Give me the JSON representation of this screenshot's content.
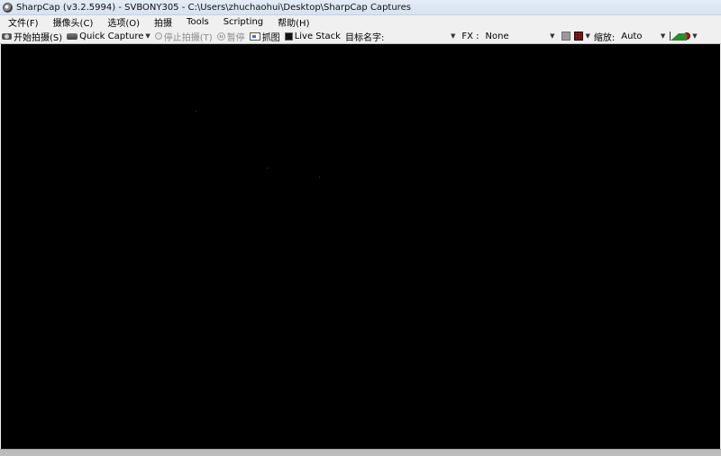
{
  "window": {
    "title": "SharpCap (v3.2.5994) - SVBONY305 - C:\\Users\\zhuchaohui\\Desktop\\SharpCap Captures"
  },
  "menu": {
    "items": [
      "文件(F)",
      "摄像头(C)",
      "选项(O)",
      "拍摄",
      "Tools",
      "Scripting",
      "帮助(H)"
    ]
  },
  "toolbar": {
    "start_capture": "开始拍摄(S)",
    "quick_capture": "Quick Capture",
    "stop_capture": "停止拍摄(T)",
    "pause": "暂停",
    "snapshot": "抓图",
    "live_stack": "Live Stack",
    "target_label": "目标名字:",
    "target_value": "",
    "fx_label": "FX :",
    "fx_value": "None",
    "zoom_label": "缩放:",
    "zoom_value": "Auto"
  },
  "icons": {
    "start_capture": "camera-icon",
    "quick_capture": "quick-capture-icon",
    "stop_capture": "stop-icon",
    "pause": "pause-icon",
    "snapshot": "snapshot-icon",
    "live_stack": "live-stack-icon",
    "histogram": "histogram-icon",
    "magnifier": "magnifier-icon"
  },
  "colors": {
    "viewport_bg": "#000000",
    "gray_swatch": "#9a9a9a",
    "red_swatch": "#5a1010",
    "histogram": "#2d8a2d"
  }
}
